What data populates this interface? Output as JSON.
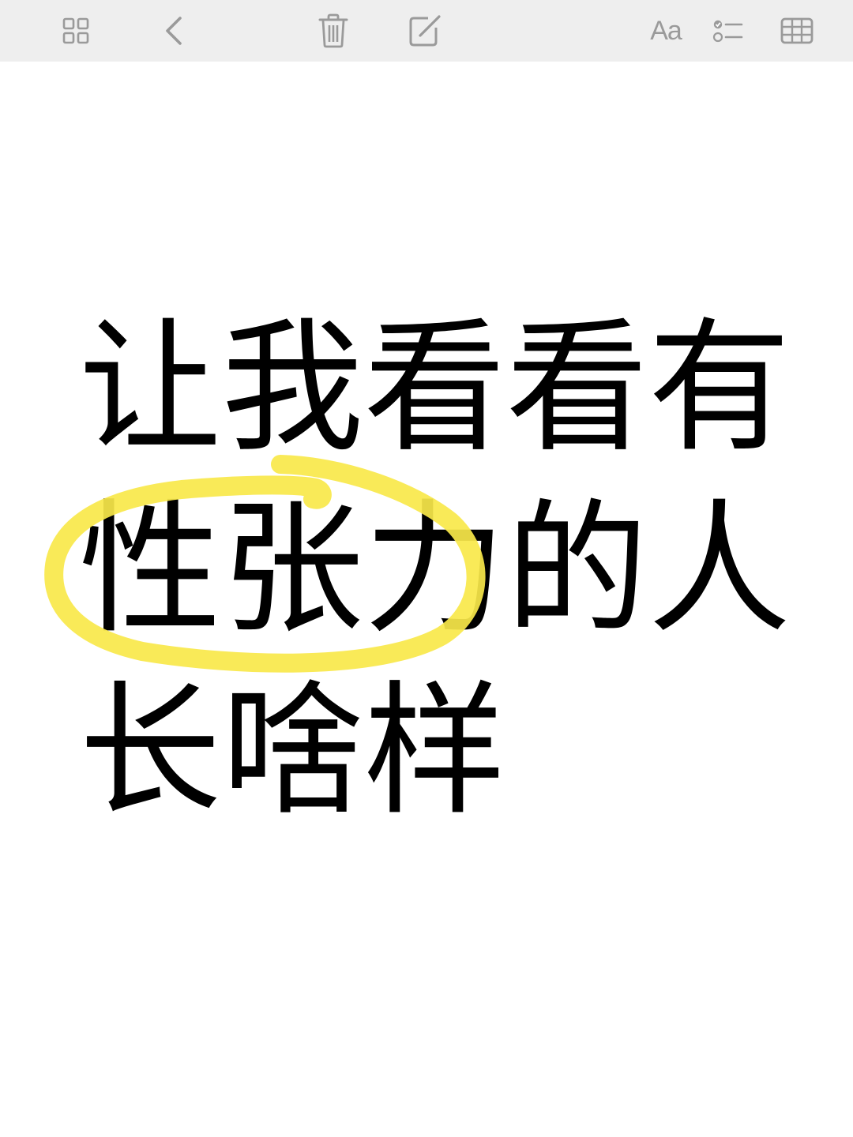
{
  "toolbar": {
    "buttons": [
      {
        "name": "gallery-view-button",
        "icon": "grid-icon"
      },
      {
        "name": "back-button",
        "icon": "chevron-left-icon"
      },
      {
        "name": "delete-button",
        "icon": "trash-icon"
      },
      {
        "name": "compose-button",
        "icon": "compose-icon"
      },
      {
        "name": "format-button",
        "icon": "text-format-icon",
        "label": "Aa"
      },
      {
        "name": "checklist-button",
        "icon": "checklist-icon"
      },
      {
        "name": "table-button",
        "icon": "table-icon"
      }
    ],
    "format_label": "Aa",
    "icon_color": "#9a9a9a",
    "background": "#eeeeee"
  },
  "note": {
    "lines": [
      "让我看看有",
      "性张力的人",
      "长啥样"
    ],
    "text_color": "#000000",
    "highlight": {
      "shape": "hand-drawn-ellipse",
      "around_text": "性张力",
      "color": "#f8e84a"
    }
  }
}
